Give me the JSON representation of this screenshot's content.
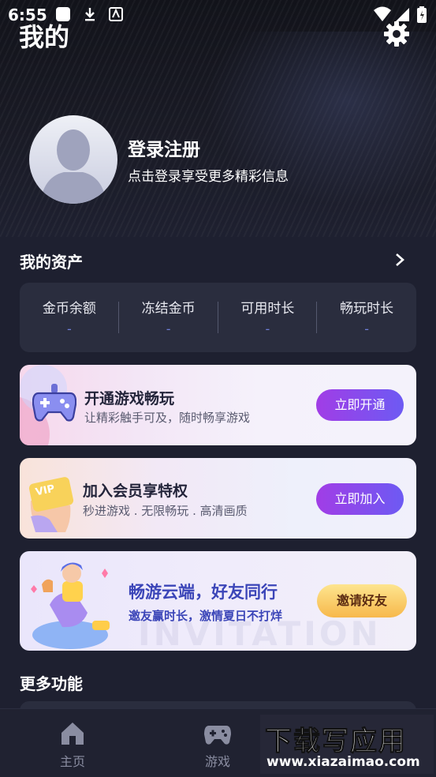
{
  "status_bar": {
    "time": "6:55"
  },
  "header": {
    "title": "我的",
    "settings_icon": "gear-icon"
  },
  "profile": {
    "title": "登录注册",
    "subtitle": "点击登录享受更多精彩信息"
  },
  "assets": {
    "title": "我的资产",
    "items": [
      {
        "label": "金币余额",
        "value": "-"
      },
      {
        "label": "冻结金币",
        "value": "-"
      },
      {
        "label": "可用时长",
        "value": "-"
      },
      {
        "label": "畅玩时长",
        "value": "-"
      }
    ]
  },
  "banners": [
    {
      "title": "开通游戏畅玩",
      "subtitle": "让精彩触手可及，随时畅享游戏",
      "button": "立即开通",
      "icon": "gamepad-icon"
    },
    {
      "title": "加入会员享特权",
      "subtitle": "秒进游戏 . 无限畅玩 . 高清画质",
      "button": "立即加入",
      "icon": "vip-card-icon",
      "badge": "VIP"
    },
    {
      "title": "畅游云端，好友同行",
      "subtitle": "邀友赢时长，激情夏日不打烊",
      "button": "邀请好友",
      "watermark": "INVITATION"
    }
  ],
  "more": {
    "title": "更多功能"
  },
  "tabbar": {
    "items": [
      {
        "label": "主页",
        "icon": "home-icon"
      },
      {
        "label": "游戏",
        "icon": "gamepad-icon"
      }
    ]
  },
  "watermark": {
    "brand": "下载写应用",
    "url": "www.xiazaimao.com"
  },
  "colors": {
    "accent_purple": "#8a4cf0",
    "gold_button": "#f9cf6a",
    "background": "#1e2030"
  }
}
